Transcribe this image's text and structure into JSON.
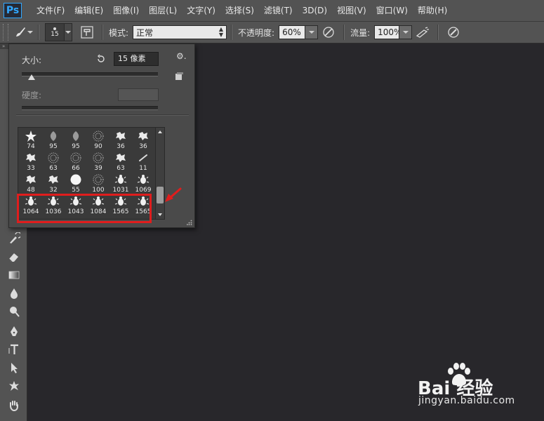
{
  "app": {
    "logo_text": "Ps"
  },
  "menu": {
    "items": [
      "文件(F)",
      "编辑(E)",
      "图像(I)",
      "图层(L)",
      "文字(Y)",
      "选择(S)",
      "滤镜(T)",
      "3D(D)",
      "视图(V)",
      "窗口(W)",
      "帮助(H)"
    ]
  },
  "options": {
    "brush_size": "15",
    "mode_label": "模式:",
    "mode_value": "正常",
    "opacity_label": "不透明度:",
    "opacity_value": "60%",
    "flow_label": "流量:",
    "flow_value": "100%"
  },
  "brush_panel": {
    "size_label": "大小:",
    "size_value": "15 像素",
    "size_slider_fraction": 0.07,
    "hardness_label": "硬度:",
    "brushes": [
      [
        "74",
        "95",
        "95",
        "90",
        "36",
        "36"
      ],
      [
        "33",
        "63",
        "66",
        "39",
        "63",
        "11"
      ],
      [
        "48",
        "32",
        "55",
        "100",
        "1031",
        "1069"
      ],
      [
        "1064",
        "1036",
        "1043",
        "1084",
        "1565",
        "1565"
      ]
    ],
    "highlight_color": "#e01d1d"
  },
  "watermark": {
    "logo_text": "Bai 经验",
    "url_text": "jingyan.baidu.com"
  }
}
